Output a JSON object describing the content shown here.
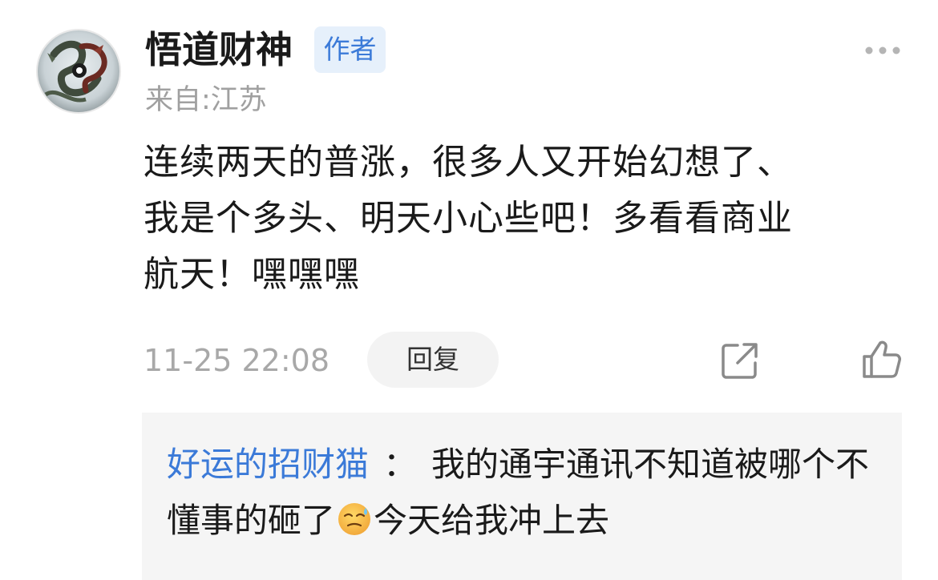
{
  "comment": {
    "author_name": "悟道财神",
    "author_badge": "作者",
    "location": "来自:江苏",
    "text": "连续两天的普涨，很多人又开始幻想了、\n我是个多头、明天小心些吧！多看看商业\n航天！嘿嘿嘿",
    "timestamp": "11-25 22:08",
    "reply_label": "回复"
  },
  "reply": {
    "user": "好运的招财猫",
    "colon": "：",
    "text_before_emoji": "我的通宇通讯不知道被哪个不懂事的砸了",
    "emoji": "sweating-face-emoji",
    "text_after_emoji": "今天给我冲上去"
  },
  "icons": {
    "more": "more-horizontal-icon",
    "share": "share-icon",
    "like": "thumbs-up-icon"
  },
  "colors": {
    "accent": "#3b7ad8",
    "badge_bg": "#e6f0fb",
    "muted": "#a0a0a0",
    "reply_bg": "#f5f5f5"
  }
}
